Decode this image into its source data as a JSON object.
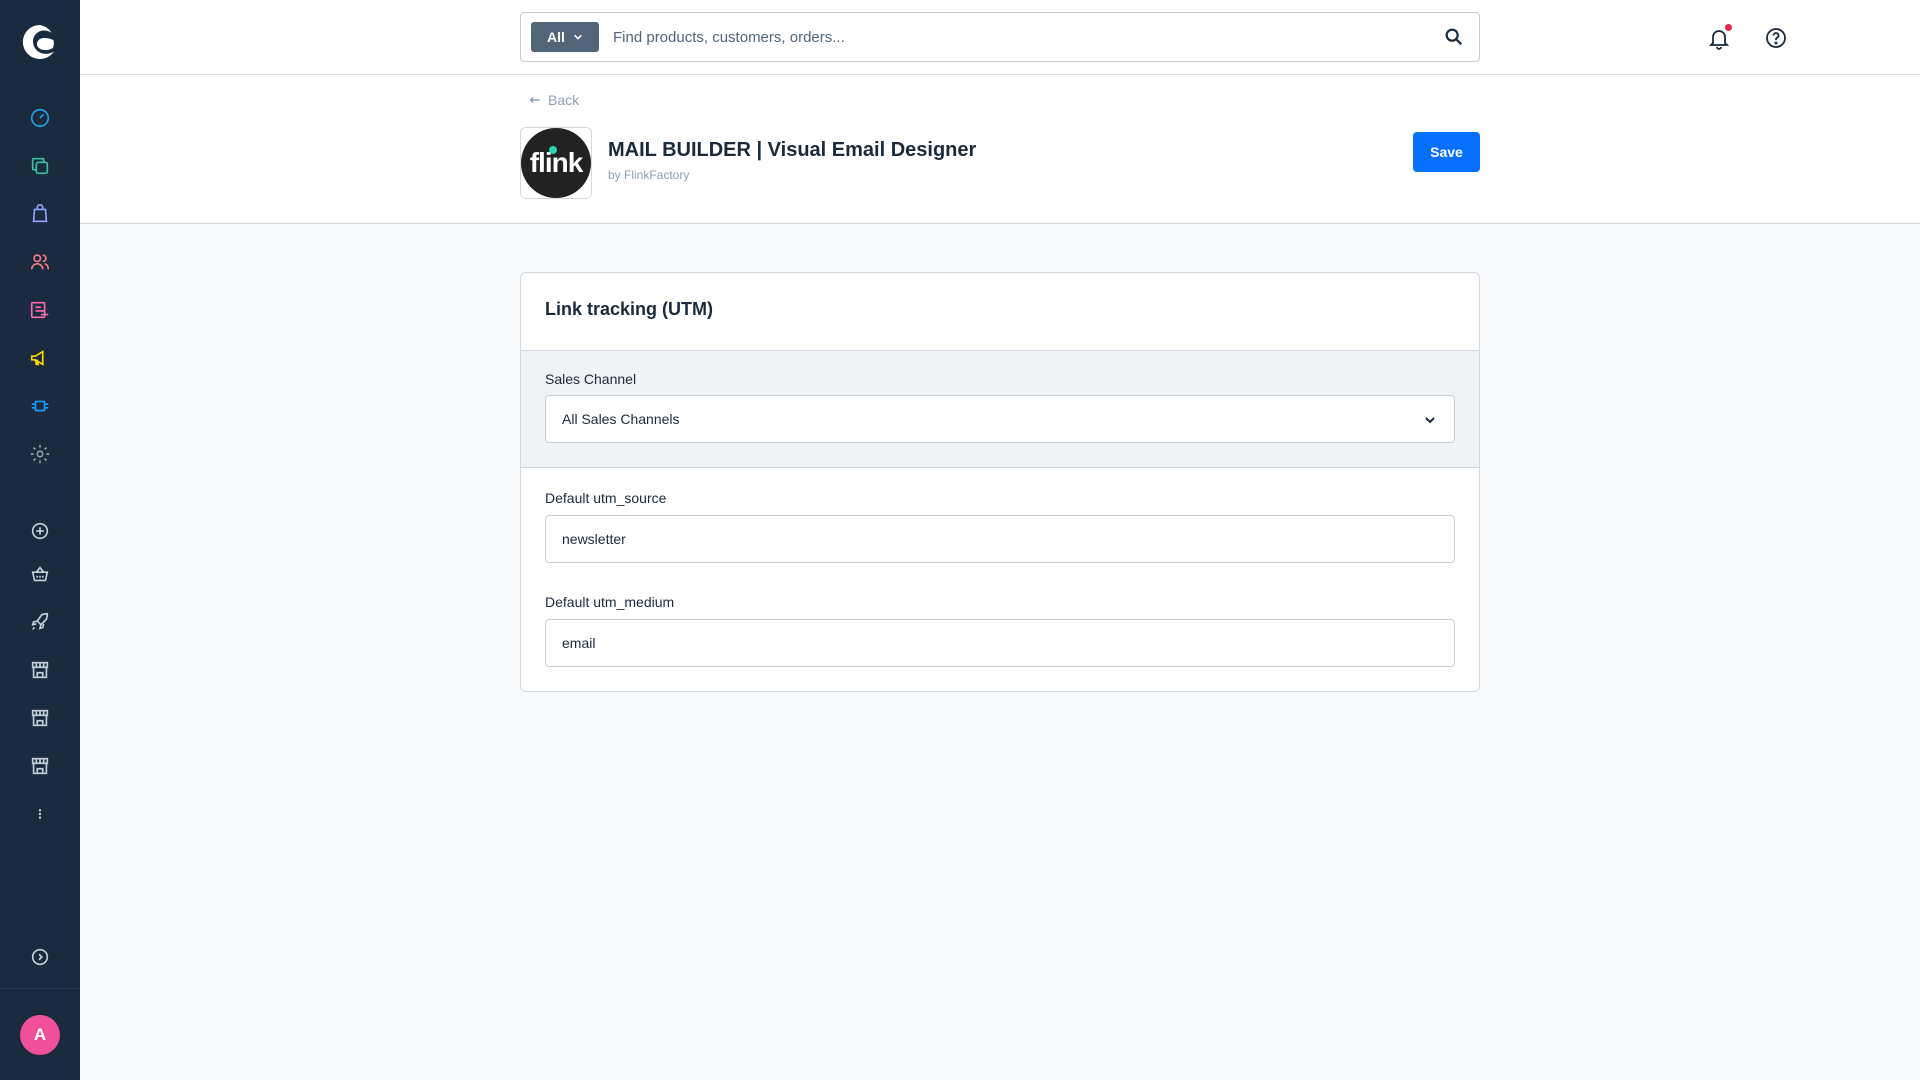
{
  "search": {
    "type_label": "All",
    "placeholder": "Find products, customers, orders..."
  },
  "header": {
    "back_label": "Back",
    "app_logo_text": "flink",
    "app_title": "MAIL BUILDER | Visual Email Designer",
    "app_vendor": "by FlinkFactory",
    "save_label": "Save"
  },
  "card": {
    "title": "Link tracking (UTM)",
    "sales_channel": {
      "label": "Sales Channel",
      "value": "All Sales Channels"
    },
    "utm_source": {
      "label": "Default utm_source",
      "value": "newsletter"
    },
    "utm_medium": {
      "label": "Default utm_medium",
      "value": "email"
    }
  },
  "user": {
    "avatar_initial": "A"
  },
  "colors": {
    "sidebar_bg": "#1b2b3f",
    "primary": "#0870ff",
    "avatar": "#f0509a",
    "notification_dot": "#de294c"
  },
  "sidebar": {
    "items": [
      {
        "icon": "dashboard-icon"
      },
      {
        "icon": "catalogue-icon"
      },
      {
        "icon": "orders-icon"
      },
      {
        "icon": "customers-icon"
      },
      {
        "icon": "content-icon"
      },
      {
        "icon": "marketing-icon"
      },
      {
        "icon": "extensions-icon"
      },
      {
        "icon": "settings-icon"
      },
      {
        "icon": "add-icon"
      },
      {
        "icon": "basket-icon"
      },
      {
        "icon": "rocket-icon"
      },
      {
        "icon": "storefront-icon"
      },
      {
        "icon": "storefront-icon"
      },
      {
        "icon": "storefront-icon"
      },
      {
        "icon": "more-icon"
      },
      {
        "icon": "expand-icon"
      }
    ]
  }
}
